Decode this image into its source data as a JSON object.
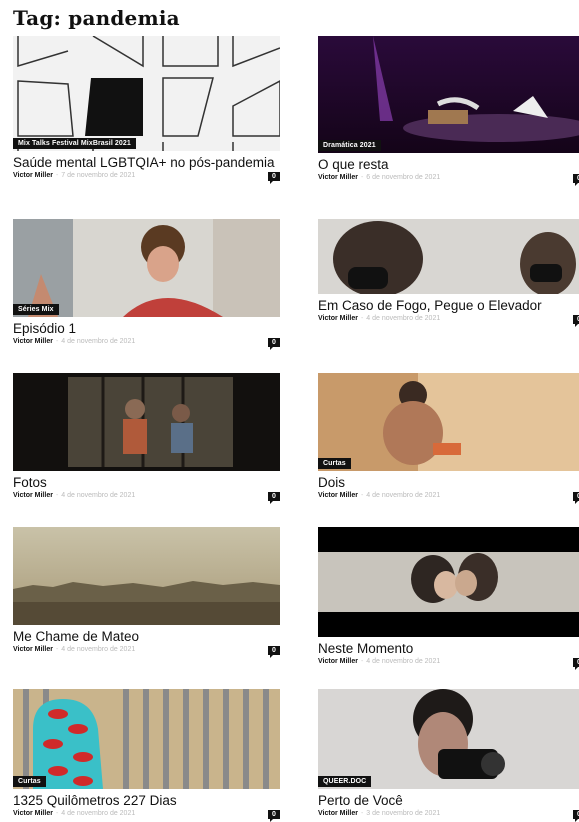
{
  "page": {
    "title": "Tag: pandemia"
  },
  "posts": [
    {
      "category": "Mix Talks Festival MixBrasil 2021",
      "title": "Saúde mental LGBTQIA+ no pós-pandemia",
      "author": "Victor Miller",
      "date": "7 de novembro de 2021",
      "comments": "0"
    },
    {
      "category": "Dramática 2021",
      "title": "O que resta",
      "author": "Victor Miller",
      "date": "6 de novembro de 2021",
      "comments": "0"
    },
    {
      "category": "Séries Mix",
      "title": "Episódio 1",
      "author": "Victor Miller",
      "date": "4 de novembro de 2021",
      "comments": "0"
    },
    {
      "category": "",
      "title": "Em Caso de Fogo, Pegue o Elevador",
      "author": "Victor Miller",
      "date": "4 de novembro de 2021",
      "comments": "0"
    },
    {
      "category": "",
      "title": "Fotos",
      "author": "Victor Miller",
      "date": "4 de novembro de 2021",
      "comments": "0"
    },
    {
      "category": "Curtas",
      "title": "Dois",
      "author": "Victor Miller",
      "date": "4 de novembro de 2021",
      "comments": "0"
    },
    {
      "category": "",
      "title": "Me Chame de Mateo",
      "author": "Victor Miller",
      "date": "4 de novembro de 2021",
      "comments": "0"
    },
    {
      "category": "",
      "title": "Neste Momento",
      "author": "Victor Miller",
      "date": "4 de novembro de 2021",
      "comments": "0"
    },
    {
      "category": "Curtas",
      "title": "1325 Quilômetros 227 Dias",
      "author": "Victor Miller",
      "date": "4 de novembro de 2021",
      "comments": "0"
    },
    {
      "category": "QUEER.DOC",
      "title": "Perto de Você",
      "author": "Victor Miller",
      "date": "3 de novembro de 2021",
      "comments": "0"
    }
  ]
}
